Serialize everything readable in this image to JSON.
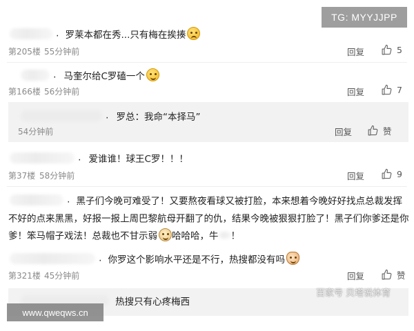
{
  "comments": [
    {
      "text": "罗莱本都在秀...只有梅在挨揍",
      "floor": "第205楼",
      "time": "55分钟前",
      "reply": "回复",
      "likes": "5",
      "emoji": "sweat-smile-icon"
    },
    {
      "text": "马奎尔给C罗磕一个",
      "floor": "第166楼",
      "time": "56分钟前",
      "reply": "回复",
      "likes": "7",
      "emoji": "smile-icon"
    },
    {
      "text": "爱谁谁！球王C罗！！！",
      "floor": "第37楼",
      "time": "58分钟前",
      "reply": "回复",
      "likes": "9"
    },
    {
      "lines": [
        "黑子们今晚可难受了！又要熬夜看球又被打脸，本来想着今晚好好找点总裁发挥",
        "不好的点来黑黑，好报一报上周巴黎航母开翻了的仇，结果今晚被狠狠打脸了！黑子们你爹还是你",
        "爹！笨马帽子戏法！总裁也不甘示弱",
        "哈哈哈，牛",
        "！"
      ],
      "floor": "",
      "time": "",
      "reply": "",
      "likes": ""
    },
    {
      "text": "你罗这个影响水平还是不行，热搜都没有吗",
      "floor": "第321楼",
      "time": "45分钟前",
      "reply": "回复",
      "likes": "赞",
      "emoji": "cat-icon"
    },
    {
      "text": "热搜只有心疼梅西"
    }
  ],
  "sub_reply": {
    "dot": ".",
    "text": "罗总：我命“本择马”",
    "time": "54分钟前",
    "reply": "回复",
    "likes": "赞"
  },
  "watermarks": {
    "tg": "TG: MYYJJPP",
    "site": "www.qweqws.cn",
    "source": "百家号 贝塔说体育"
  },
  "dots": {
    "c1": ".",
    "c2": ".",
    "c3": ".",
    "c4": ".",
    "c5": "."
  },
  "colors": {
    "meta": "#8a8a8a",
    "subbox_bg": "#f2f2f2"
  }
}
